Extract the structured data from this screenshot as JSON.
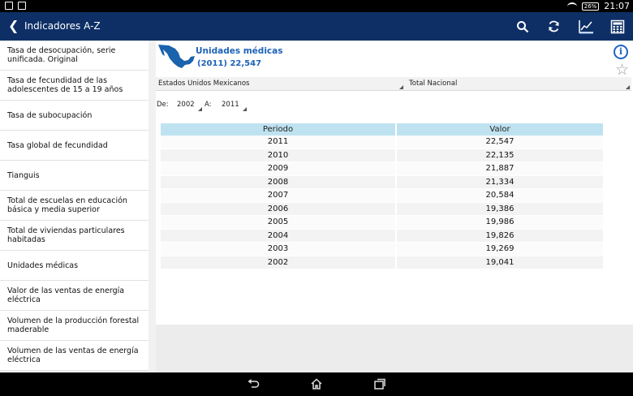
{
  "status": {
    "battery": "26%",
    "time": "21:07"
  },
  "appbar": {
    "title": "Indicadores A-Z"
  },
  "sidebar": {
    "items": [
      "Tasa de desocupación, serie unificada. Original",
      "Tasa de fecundidad de las adolescentes de 15 a 19 años",
      "Tasa de subocupación",
      "Tasa global de fecundidad",
      "Tianguis",
      "Total de escuelas en educación básica y media superior",
      "Total de viviendas particulares habitadas",
      "Unidades médicas",
      "Valor de las ventas de energía eléctrica",
      "Volumen de la producción forestal maderable",
      "Volumen de las ventas de energía eléctrica"
    ]
  },
  "indicator": {
    "name": "Unidades médicas",
    "value": "(2011) 22,547"
  },
  "filters": {
    "region": "Estados Unidos Mexicanos",
    "scope": "Total Nacional"
  },
  "range": {
    "from_label": "De:",
    "from_value": "2002",
    "to_label": "A:",
    "to_value": "2011"
  },
  "table": {
    "headers": [
      "Periodo",
      "Valor"
    ],
    "rows": [
      [
        "2011",
        "22,547"
      ],
      [
        "2010",
        "22,135"
      ],
      [
        "2009",
        "21,887"
      ],
      [
        "2008",
        "21,334"
      ],
      [
        "2007",
        "20,584"
      ],
      [
        "2006",
        "19,386"
      ],
      [
        "2005",
        "19,986"
      ],
      [
        "2004",
        "19,826"
      ],
      [
        "2003",
        "19,269"
      ],
      [
        "2002",
        "19,041"
      ]
    ]
  }
}
